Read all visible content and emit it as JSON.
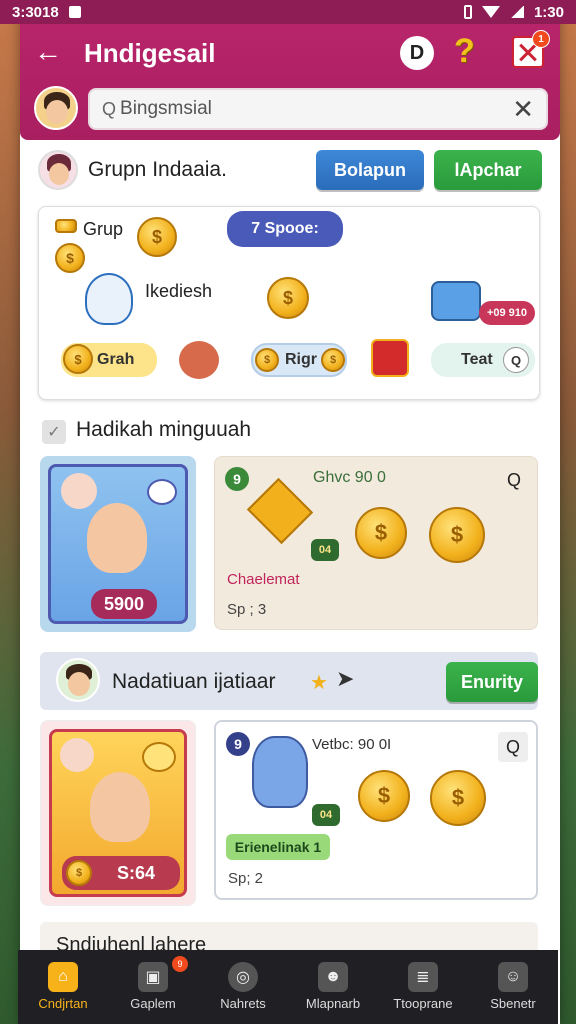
{
  "statusbar": {
    "left_time": "3:3018",
    "right_time": "1:30"
  },
  "header": {
    "title": "Hndigesail",
    "d_label": "D",
    "q_label": "?",
    "badge": "1"
  },
  "search": {
    "value": "Bingsmsial",
    "placeholder": "Bingsmsial"
  },
  "group": {
    "title": "Grupn Indaaia.",
    "btn_blue": "Bolapun",
    "btn_green": "lApchar"
  },
  "card1": {
    "grup_label": "Grup",
    "spoon_pill": "7 Spooe:",
    "char_label": "Ikediesh",
    "price_tag": "+09 910",
    "pill_grah": "Grah",
    "pill_rigr": "Rigr",
    "pill_teat": "Teat"
  },
  "section": {
    "title": "Hadikah minguuah"
  },
  "reward1": {
    "price": "5900",
    "badge": "9",
    "title": "Ghvc 90 0",
    "chip": "04",
    "label": "Chaelemat",
    "sub": "Sp ; 3"
  },
  "banner": {
    "title": "Nadatiuan ijatiaar",
    "button": "Enurity"
  },
  "reward2": {
    "price": "S:64",
    "badge": "9",
    "title": "Vetbc: 90 0I",
    "chip": "04",
    "label": "Erienelinak",
    "label_suffix": "1",
    "sub": "Sp; 2"
  },
  "partial": {
    "text": "Sndiuhenl lahere"
  },
  "nav": [
    {
      "label": "Cndjrtan",
      "icon": "home-icon"
    },
    {
      "label": "Gaplem",
      "icon": "gift-icon",
      "badge": "9"
    },
    {
      "label": "Nahrets",
      "icon": "target-icon"
    },
    {
      "label": "Mlapnarb",
      "icon": "people-icon"
    },
    {
      "label": "Ttooprane",
      "icon": "list-icon"
    },
    {
      "label": "Sbenetr",
      "icon": "profile-icon"
    }
  ],
  "colors": {
    "header": "#b8246a",
    "accent_green": "#2a9a3b",
    "accent_blue": "#2a6cba",
    "coin": "#f2b11c"
  }
}
